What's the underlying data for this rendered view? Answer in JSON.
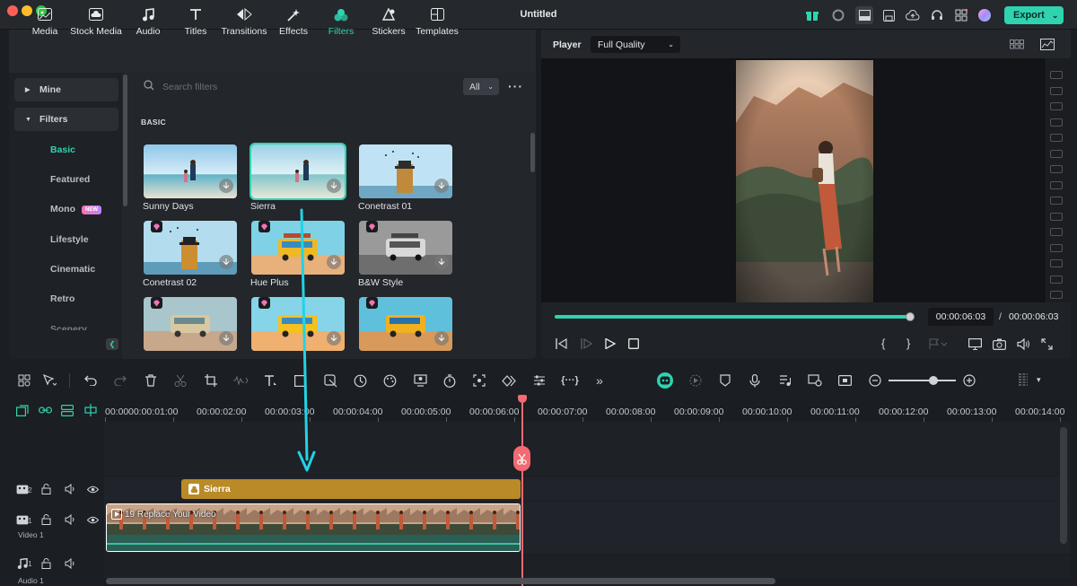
{
  "window": {
    "title": "Untitled",
    "export_label": "Export"
  },
  "tabs": [
    {
      "label": "Media",
      "icon": "media-icon"
    },
    {
      "label": "Stock Media",
      "icon": "stock-media-icon"
    },
    {
      "label": "Audio",
      "icon": "music-note-icon"
    },
    {
      "label": "Titles",
      "icon": "text-icon"
    },
    {
      "label": "Transitions",
      "icon": "transitions-icon"
    },
    {
      "label": "Effects",
      "icon": "effects-icon"
    },
    {
      "label": "Filters",
      "icon": "filters-icon"
    },
    {
      "label": "Stickers",
      "icon": "stickers-icon"
    },
    {
      "label": "Templates",
      "icon": "templates-icon"
    }
  ],
  "sidebar": {
    "mine": "Mine",
    "filters": "Filters",
    "items": [
      "Basic",
      "Featured",
      "Mono",
      "Lifestyle",
      "Cinematic",
      "Retro",
      "Scenery"
    ],
    "new_badge": "NEW"
  },
  "search": {
    "placeholder": "Search filters",
    "dropdown_value": "All"
  },
  "section_header": "BASIC",
  "filters": [
    "Sunny Days",
    "Sierra",
    "Conetrast 01",
    "Conetrast 02",
    "Hue Plus",
    "B&W Style",
    "",
    "",
    ""
  ],
  "player": {
    "label": "Player",
    "quality": "Full Quality",
    "progress": 1.0,
    "current_time": "00:00:06:03",
    "separator": "/",
    "total_time": "00:00:06:03"
  },
  "ruler": [
    "00:00",
    "00:00:01:00",
    "00:00:02:00",
    "00:00:03:00",
    "00:00:04:00",
    "00:00:05:00",
    "00:00:06:00",
    "00:00:07:00",
    "00:00:08:00",
    "00:00:09:00",
    "00:00:10:00",
    "00:00:11:00",
    "00:00:12:00",
    "00:00:13:00",
    "00:00:14:00"
  ],
  "tracks": {
    "video2": "2",
    "video1": "1",
    "video1_name": "Video 1",
    "audio1": "1",
    "audio1_name": "Audio 1"
  },
  "clips": {
    "filter_clip": "Sierra",
    "video_clip": "19 Replace Your Video"
  },
  "colors": {
    "accent": "#2fd3b0",
    "playhead": "#f36a72",
    "filter_clip": "#b98a27",
    "drag_arrow": "#22d3e6"
  }
}
